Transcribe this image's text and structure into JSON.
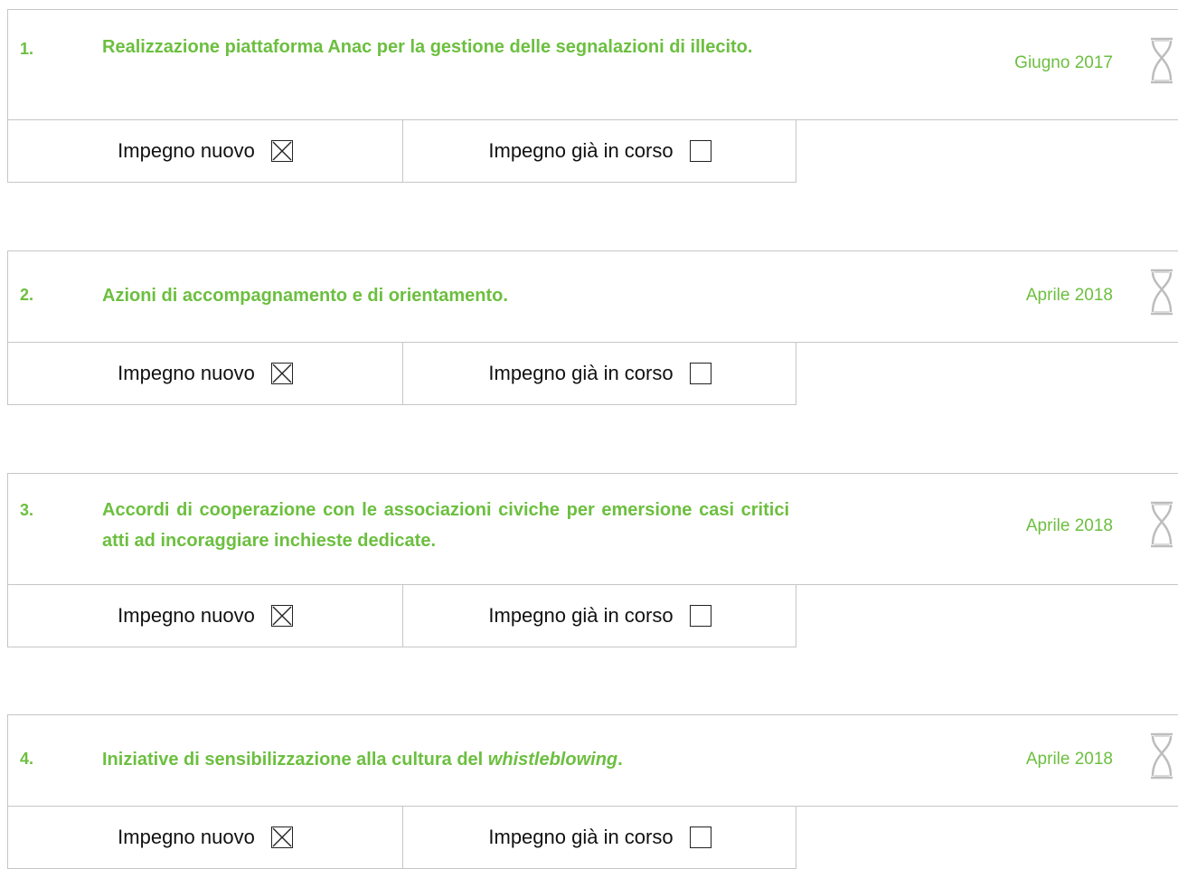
{
  "colors": {
    "accent": "#6cbf3f",
    "border": "#c6c6c6",
    "text": "#111111",
    "icon": "#bdbdbd"
  },
  "items": [
    {
      "number": "1.",
      "title": "Realizzazione piattaforma Anac per la gestione delle segnalazioni di illecito.",
      "title_plain": "",
      "title_em": "",
      "title_tail": "",
      "date": "Giugno 2017",
      "new_label": "Impegno nuovo",
      "new_checked": true,
      "ongoing_label": "Impegno già in corso",
      "ongoing_checked": false,
      "icon": "hourglass-icon"
    },
    {
      "number": "2.",
      "title": "Azioni di accompagnamento e di orientamento.",
      "title_plain": "",
      "title_em": "",
      "title_tail": "",
      "date": "Aprile 2018",
      "new_label": "Impegno nuovo",
      "new_checked": true,
      "ongoing_label": "Impegno già in corso",
      "ongoing_checked": false,
      "icon": "hourglass-icon"
    },
    {
      "number": "3.",
      "title": "Accordi di cooperazione con le associazioni civiche per emersione casi critici atti ad incoraggiare inchieste dedicate.",
      "title_plain": "",
      "title_em": "",
      "title_tail": "",
      "date": "Aprile 2018",
      "new_label": "Impegno nuovo",
      "new_checked": true,
      "ongoing_label": "Impegno già in corso",
      "ongoing_checked": false,
      "icon": "hourglass-icon"
    },
    {
      "number": "4.",
      "title": "",
      "title_plain": "Iniziative di sensibilizzazione alla cultura del ",
      "title_em": "whistleblowing",
      "title_tail": ".",
      "date": "Aprile 2018",
      "new_label": "Impegno nuovo",
      "new_checked": true,
      "ongoing_label": "Impegno già in corso",
      "ongoing_checked": false,
      "icon": "hourglass-icon"
    }
  ]
}
